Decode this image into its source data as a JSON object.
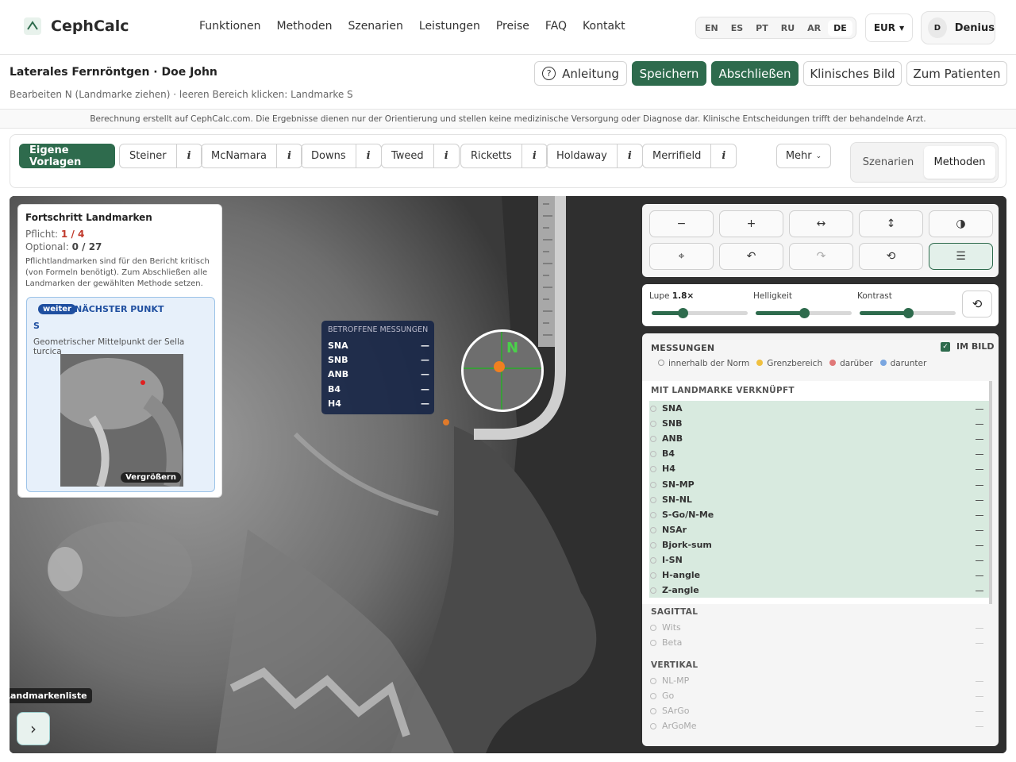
{
  "app": {
    "name": "CephCalc"
  },
  "nav": {
    "links": [
      "Funktionen",
      "Methoden",
      "Szenarien",
      "Leistungen",
      "Preise",
      "FAQ",
      "Kontakt"
    ]
  },
  "languages": {
    "items": [
      "EN",
      "ES",
      "PT",
      "RU",
      "AR",
      "DE"
    ],
    "active": "DE"
  },
  "currency": {
    "label": "EUR"
  },
  "user": {
    "initial": "D",
    "name": "Denius"
  },
  "page": {
    "title": "Laterales Fernröntgen · Doe John",
    "subtitle": "Bearbeiten N (Landmarke ziehen) · leeren Bereich klicken: Landmarke S"
  },
  "header_buttons": {
    "guide": "Anleitung",
    "save": "Speichern",
    "finish": "Abschließen",
    "clinical": "Klinisches Bild",
    "patient": "Zum Patienten"
  },
  "disclaimer": "Berechnung erstellt auf CephCalc.com. Die Ergebnisse dienen nur der Orientierung und stellen keine medizinische Versorgung oder Diagnose dar. Klinische Entscheidungen trifft der behandelnde Arzt.",
  "methods": {
    "own": "Eigene Vorlagen",
    "items": [
      "Steiner",
      "McNamara",
      "Downs",
      "Tweed",
      "Ricketts",
      "Holdaway",
      "Merrifield"
    ],
    "info": "i",
    "more": "Mehr",
    "tabs": [
      "Szenarien",
      "Methoden"
    ],
    "active_tab": "Methoden"
  },
  "progress": {
    "title": "Fortschritt Landmarken",
    "required_label": "Pflicht:",
    "required_value": "1 / 4",
    "optional_label": "Optional:",
    "optional_value": "0 / 27",
    "note": "Pflichtlandmarken sind für den Bericht kritisch (von Formeln benötigt). Zum Abschließen alle Landmarken der gewählten Methode setzen.",
    "next_badge": "weiter",
    "next_label": "NÄCHSTER PUNKT",
    "next_point": "S",
    "next_desc": "Geometrischer Mittelpunkt der Sella turcica",
    "enlarge": "Vergrößern"
  },
  "affected": {
    "title": "BETROFFENE MESSUNGEN",
    "items": [
      {
        "name": "SNA",
        "value": "—"
      },
      {
        "name": "SNB",
        "value": "—"
      },
      {
        "name": "ANB",
        "value": "—"
      },
      {
        "name": "B4",
        "value": "—"
      },
      {
        "name": "H4",
        "value": "—"
      }
    ]
  },
  "magnifier": {
    "label": "N"
  },
  "tools": {
    "zoom_out": "−",
    "zoom_in": "+",
    "flip_h": "↔",
    "flip_v": "↕",
    "invert": "◑",
    "calibrate": "⌖",
    "undo": "↶",
    "redo": "↷",
    "reset": "⟲",
    "settings": "☰"
  },
  "sliders": {
    "lupe_label": "Lupe",
    "lupe_value": "1.8×",
    "lupe_level": 0.32,
    "brightness_label": "Helligkeit",
    "brightness_level": 0.5,
    "contrast_label": "Kontrast",
    "contrast_level": 0.5
  },
  "measurements": {
    "title": "MESSUNGEN",
    "in_image": "IM BILD",
    "legend": [
      {
        "label": "innerhalb der Norm",
        "color": "#ffffff"
      },
      {
        "label": "Grenzbereich",
        "color": "#f0c040"
      },
      {
        "label": "darüber",
        "color": "#e07878"
      },
      {
        "label": "darunter",
        "color": "#7aa6e0"
      }
    ],
    "linked_title": "MIT LANDMARKE VERKNÜPFT",
    "linked": [
      "SNA",
      "SNB",
      "ANB",
      "B4",
      "H4",
      "SN-MP",
      "SN-NL",
      "S-Go/N-Me",
      "NSAr",
      "Bjork-sum",
      "I-SN",
      "H-angle",
      "Z-angle"
    ],
    "sagittal_title": "SAGITTAL",
    "sagittal": [
      "Wits",
      "Beta"
    ],
    "vertical_title": "VERTIKAL",
    "vertical": [
      "NL-MP",
      "Go",
      "SArGo",
      "ArGoMe"
    ]
  },
  "landmark_list": {
    "label": "Landmarkenliste",
    "toggle": "›"
  }
}
